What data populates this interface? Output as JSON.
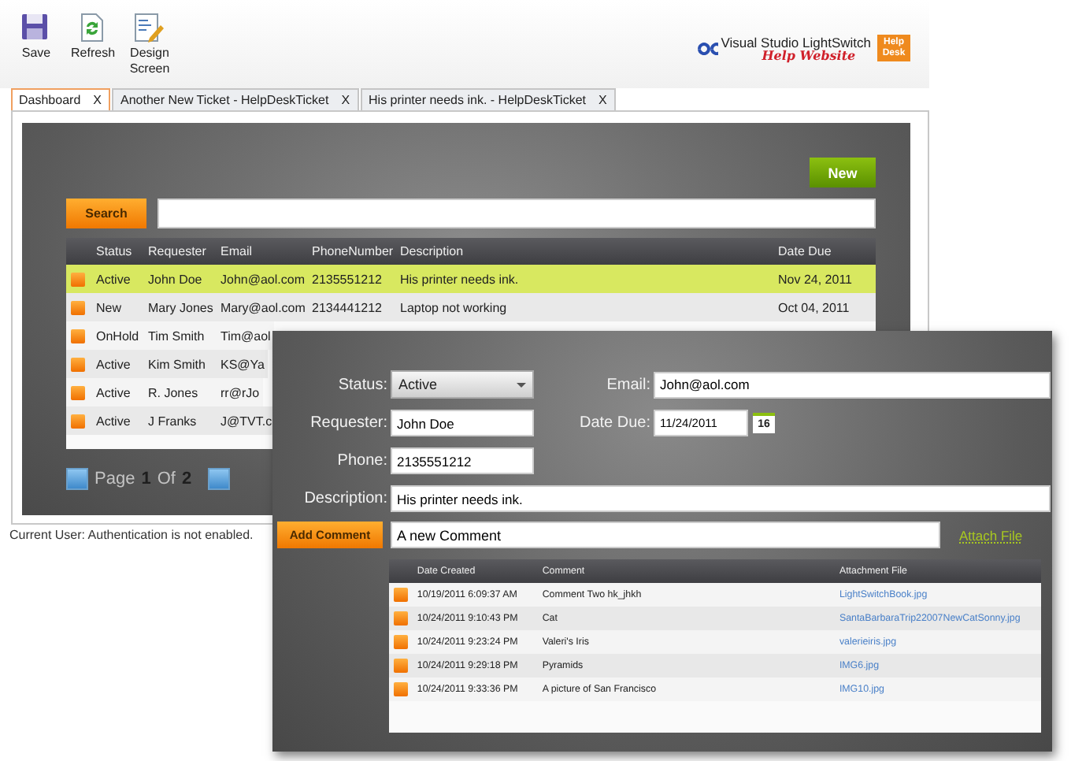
{
  "toolbar": [
    {
      "label": "Save",
      "kind": "save"
    },
    {
      "label": "Refresh",
      "kind": "refresh"
    },
    {
      "label": "Design Screen",
      "kind": "design"
    }
  ],
  "logo": {
    "product": "Visual Studio LightSwitch",
    "script": "Help Website",
    "badge": "Help Desk"
  },
  "tabs": [
    {
      "label": "Dashboard",
      "close": "X",
      "selected": true
    },
    {
      "label": "Another New Ticket - HelpDeskTicket",
      "close": "X",
      "selected": false
    },
    {
      "label": "His printer needs ink. - HelpDeskTicket",
      "close": "X",
      "selected": false
    }
  ],
  "dashboard": {
    "new_button": "New",
    "search_button": "Search",
    "table": {
      "columns": [
        "Status",
        "Requester",
        "Email",
        "PhoneNumber",
        "Description",
        "Date Due"
      ],
      "rows": [
        {
          "cells": [
            "Active",
            "John Doe",
            "John@aol.com",
            "2135551212",
            "His printer needs ink.",
            "Nov 24, 2011"
          ],
          "selected": true
        },
        {
          "cells": [
            "New",
            "Mary Jones",
            "Mary@aol.com",
            "2134441212",
            "Laptop not working",
            "Oct 04, 2011"
          ],
          "selected": false
        },
        {
          "cells": [
            "OnHold",
            "Tim Smith",
            "Tim@aol"
          ],
          "selected": false
        },
        {
          "cells": [
            "Active",
            "Kim Smith",
            "KS@Ya"
          ],
          "selected": false
        },
        {
          "cells": [
            "Active",
            "R. Jones",
            "rr@rJo"
          ],
          "selected": false
        },
        {
          "cells": [
            "Active",
            "J Franks",
            "J@TVT.c"
          ],
          "selected": false
        }
      ]
    },
    "pager": {
      "page_label": "Page",
      "page": "1",
      "of_label": "Of",
      "total": "2"
    }
  },
  "status_bar": "Current User: Authentication is not enabled.",
  "detail": {
    "status": {
      "label": "Status:",
      "value": "Active"
    },
    "email": {
      "label": "Email:",
      "value": "John@aol.com"
    },
    "requester": {
      "label": "Requester:",
      "value": "John Doe"
    },
    "date_due": {
      "label": "Date Due:",
      "value": "11/24/2011",
      "calendar": "16"
    },
    "phone": {
      "label": "Phone:",
      "value": "2135551212"
    },
    "description": {
      "label": "Description:",
      "value": "His printer needs ink."
    },
    "add_comment_button": "Add Comment",
    "comment_value": "A new Comment",
    "attach_link": "Attach File",
    "comments": {
      "columns": [
        "Date Created",
        "Comment",
        "Attachment File"
      ],
      "rows": [
        {
          "cells": [
            "10/19/2011 6:09:37 AM",
            "Comment Two hk_jhkh",
            "LightSwitchBook.jpg"
          ]
        },
        {
          "cells": [
            "10/24/2011 9:10:43 PM",
            "Cat",
            "SantaBarbaraTrip22007NewCatSonny.jpg"
          ]
        },
        {
          "cells": [
            "10/24/2011 9:23:24 PM",
            "Valeri's Iris",
            "valerieiris.jpg"
          ]
        },
        {
          "cells": [
            "10/24/2011 9:29:18 PM",
            "Pyramids",
            "IMG6.jpg"
          ]
        },
        {
          "cells": [
            "10/24/2011 9:33:36 PM",
            "A picture of San Francisco",
            "IMG10.jpg"
          ]
        }
      ]
    }
  }
}
